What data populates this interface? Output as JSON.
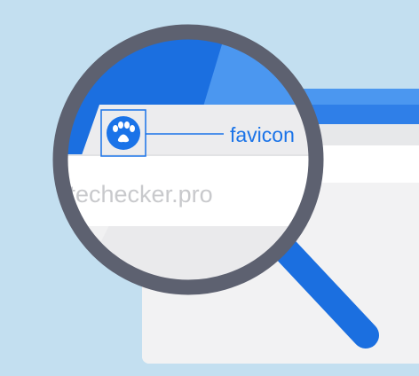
{
  "callout": {
    "label": "favicon"
  },
  "address_bar": {
    "url": "sitechecker.pro"
  },
  "tab": {
    "icon": "paw-icon"
  },
  "colors": {
    "background": "#c3dff0",
    "brand_blue": "#1a73e8",
    "frame_blue_dark": "#1b6fe0",
    "frame_blue_light": "#4b97f0",
    "lens_rim": "#5d6170",
    "url_text": "#c8c9cc",
    "label_text": "#1a73e8"
  }
}
